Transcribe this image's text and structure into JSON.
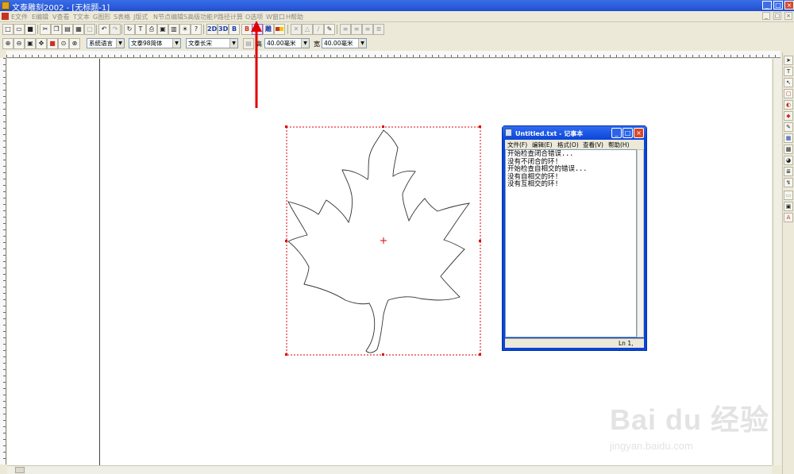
{
  "app": {
    "title": "文泰雕刻2002 - [无标题-1]",
    "window_controls": [
      "_",
      "□",
      "×"
    ]
  },
  "menu": [
    "E文件",
    "E编辑",
    "V查看",
    "T文本",
    "G图形",
    "S表格",
    "J版式",
    "N节点编辑",
    "S高级功能",
    "P路径计算",
    "O选项",
    "W窗口",
    "H帮助"
  ],
  "toolbar1": {
    "buttons": [
      "new",
      "open",
      "save",
      "cut",
      "copy",
      "paste",
      "print-preview",
      "undo",
      "redo",
      "redo2",
      "script",
      "text-tool",
      "print",
      "scan",
      "image",
      "bulb",
      "help"
    ],
    "text_buttons": [
      "2D",
      "3D",
      "B",
      "B"
    ],
    "highlight_icon": "check-closed-icon",
    "colors": [
      "#c8331f",
      "#1c3da8",
      "#f2c300"
    ]
  },
  "toolbar2": {
    "font_language": "系统语言",
    "font_name": "文泰98简体",
    "font_style": "文泰长宋",
    "height_label": "高",
    "height_value": "40.00毫米",
    "width_label": "宽",
    "width_value": "40.00毫米"
  },
  "notepad": {
    "title": "Untitled.txt - 记事本",
    "menu": [
      "文件(F)",
      "编辑(E)",
      "格式(O)",
      "查看(V)",
      "帮助(H)"
    ],
    "lines": [
      "开始检查闭合错误...",
      "没有不闭合的环!",
      "开始检查自相交的错误...",
      "没有自相交的环!",
      "没有互相交的环!"
    ],
    "status": "Ln 1,"
  },
  "annotation": {
    "arrow_color": "#e00000"
  },
  "watermark": {
    "main": "Bai du 经验",
    "sub": "jingyan.baidu.com"
  }
}
